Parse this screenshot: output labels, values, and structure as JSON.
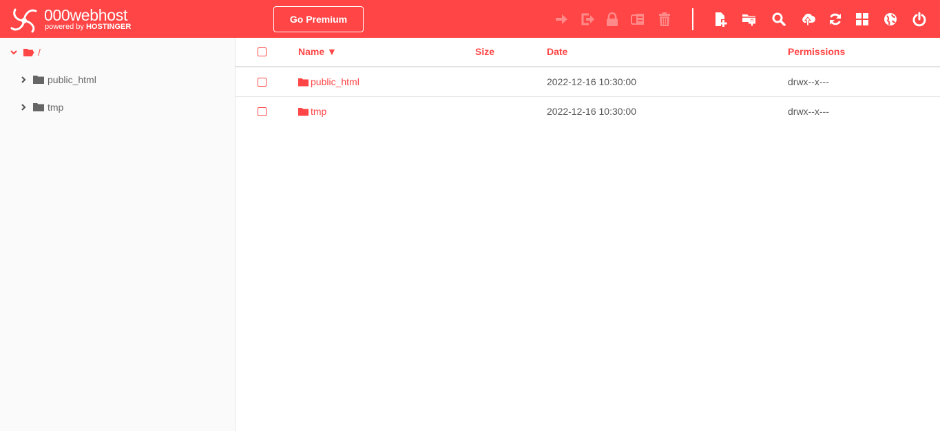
{
  "brand": {
    "name": "000webhost",
    "tagline_prefix": "powered by",
    "tagline_brand": "HOSTINGER"
  },
  "header": {
    "premium_label": "Go Premium",
    "actions_disabled": [
      "move-icon",
      "rename-icon",
      "permissions-lock-icon",
      "archive-icon",
      "delete-icon"
    ],
    "actions": [
      "new-file-icon",
      "new-folder-icon",
      "search-icon",
      "upload-icon",
      "refresh-icon",
      "view-grid-icon",
      "globe-icon",
      "power-icon"
    ]
  },
  "sidebar": {
    "root": {
      "label": "/"
    },
    "items": [
      {
        "label": "public_html"
      },
      {
        "label": "tmp"
      }
    ]
  },
  "table": {
    "headers": {
      "name": "Name ▼",
      "size": "Size",
      "date": "Date",
      "permissions": "Permissions"
    },
    "rows": [
      {
        "name": "public_html",
        "size": "",
        "date": "2022-12-16 10:30:00",
        "permissions": "drwx--x---"
      },
      {
        "name": "tmp",
        "size": "",
        "date": "2022-12-16 10:30:00",
        "permissions": "drwx--x---"
      }
    ]
  },
  "colors": {
    "accent": "#ff4545",
    "disabled_icon": "#ff8a8a",
    "text": "#555555",
    "sidebar_bg": "#fafafa"
  }
}
